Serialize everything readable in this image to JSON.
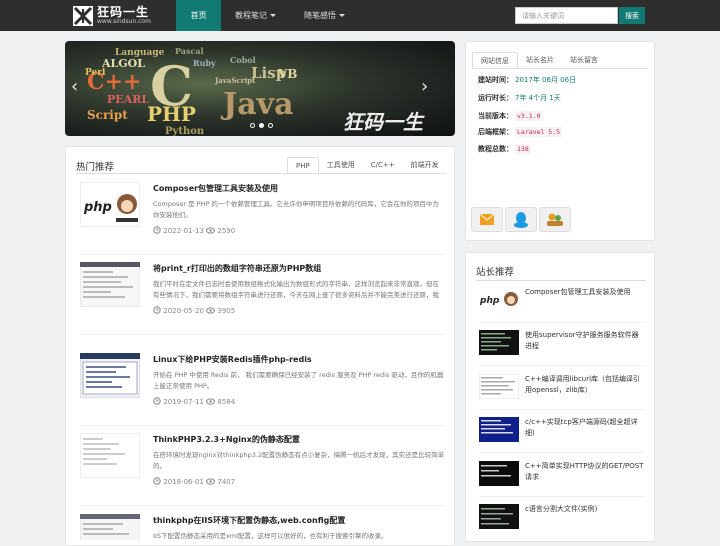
{
  "brand": {
    "name": "狂码一生",
    "domain": "www.sindsun.com"
  },
  "nav": {
    "items": [
      {
        "label": "首页"
      },
      {
        "label": "教程笔记"
      },
      {
        "label": "随笔感悟"
      }
    ]
  },
  "search": {
    "placeholder": "请输入关键词",
    "button": "搜索"
  },
  "banner": {
    "words": [
      "Language",
      "Pascal",
      "C++",
      "ALGOL",
      "C",
      "Java",
      "PHP",
      "PEARL",
      "Script",
      "Lisp",
      "VB",
      "Python",
      "Ruby",
      "Cobol",
      "Perl",
      "JavaScript"
    ],
    "signature": "狂码一生"
  },
  "site_info": {
    "tabs": [
      "网站信息",
      "站长名片",
      "站长留言"
    ],
    "rows": [
      {
        "label": "建站时间：",
        "value": "2017年 06月 06日"
      },
      {
        "label": "运行时长：",
        "value": "7年 4个月 1天"
      },
      {
        "label": "当前版本：",
        "value": "v3.1.0"
      },
      {
        "label": "后端框架：",
        "value": "Laravel 5.5"
      },
      {
        "label": "教程总数：",
        "value": "138"
      }
    ],
    "social": [
      "mail-icon",
      "qq-icon",
      "users-icon"
    ]
  },
  "hot": {
    "title": "热门推荐",
    "tabs": [
      "PHP",
      "工具使用",
      "C/C++",
      "前端开发"
    ],
    "articles": [
      {
        "title": "Composer包管理工具安装及使用",
        "desc": "Composer 是 PHP 的一个依赖管理工具。它允许你申明项目所依赖的代码库，它会在你的项目中为你安装他们。",
        "date": "2022-01-13",
        "views": "2590"
      },
      {
        "title": "将print_r打印出的数组字符串还原为PHP数组",
        "desc": "我们平时在定文件日志时会使用数组格式化输出为数组形式的字符串，这样浏览起来非常直观，但在有些情况下，我们需要将数组字符串进行还原，今天在网上查了很多资料后并不能完美进行还原，我就自己尝试多次后，写了一个方法专门进入处理数组字符串还原为数组。",
        "date": "2020-05-20",
        "views": "3905"
      },
      {
        "title": "Linux下给PHP安装Redis插件php-redis",
        "desc": "开始在 PHP 中使用 Redis 前， 我们需要确保已经安装了 redis 服务及 PHP redis 驱动，且你的机器上能正常使用 PHP。",
        "date": "2019-07-11",
        "views": "8584"
      },
      {
        "title": "ThinkPHP3.2.3+Nginx的伪静态配置",
        "desc": "在搭环境时发现nginx对thinkphp3.2配置伪静态有点小复杂，搞腾一帆后才发现，其实还是比较简单的。",
        "date": "2018-06-01",
        "views": "7407"
      },
      {
        "title": "thinkphp在IIS环境下配置伪静态,web.config配置",
        "desc": "IIS下配置伪静态采用的是xml配置，这样可以很好的，也有利于搜索引擎的收录。",
        "date": "",
        "views": ""
      }
    ]
  },
  "recommend": {
    "title": "站长推荐",
    "items": [
      {
        "title": "Composer包管理工具安装及使用"
      },
      {
        "title": "使用supervisor守护服务服务软件器进程"
      },
      {
        "title": "C++编译调用libcurl库（包括编译引用openssl，zlib库）"
      },
      {
        "title": "c/c++实现tcp客户端源码(超全超详细)"
      },
      {
        "title": "C++简单实现HTTP协议的GET/POST请求"
      },
      {
        "title": "c语言分割大文件(实例)"
      }
    ]
  }
}
